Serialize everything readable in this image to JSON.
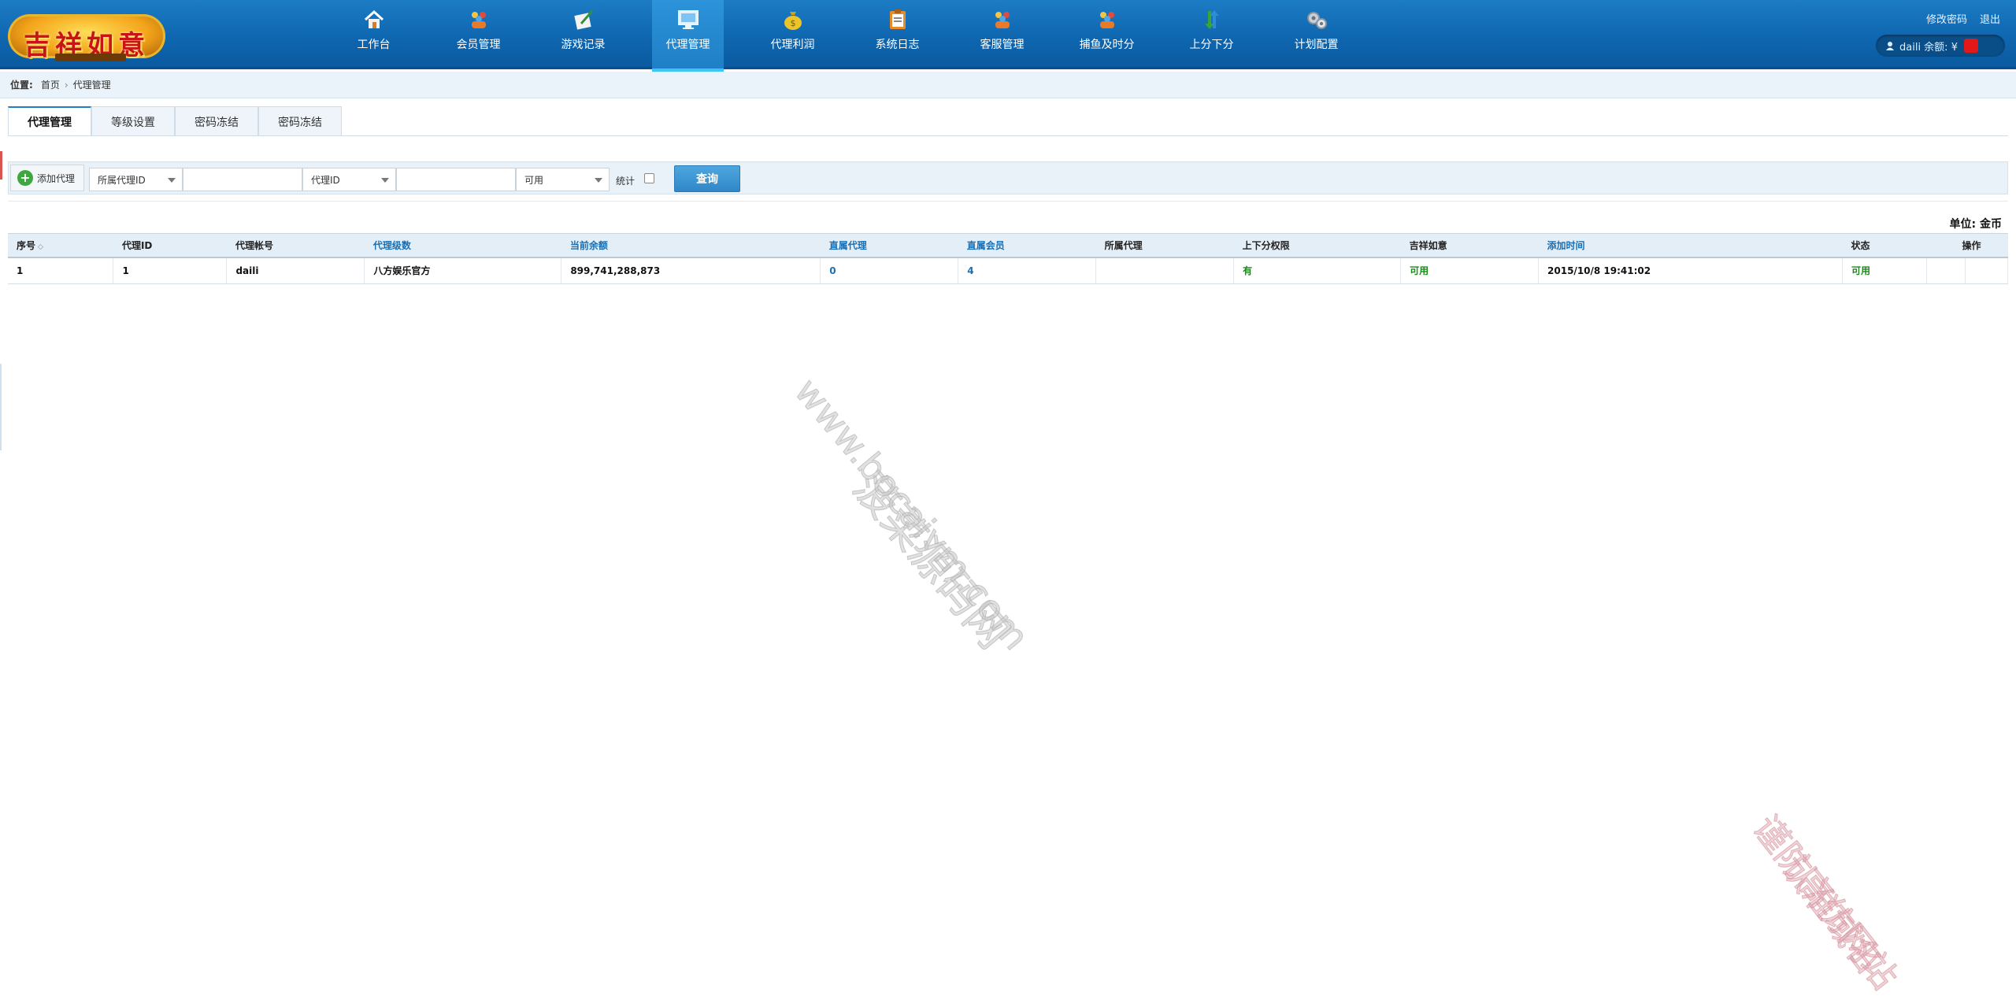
{
  "logo": {
    "text": "吉祥如意"
  },
  "nav": [
    {
      "label": "工作台",
      "icon": "home-icon"
    },
    {
      "label": "会员管理",
      "icon": "members-icon"
    },
    {
      "label": "游戏记录",
      "icon": "game-record-icon"
    },
    {
      "label": "代理管理",
      "icon": "monitor-icon"
    },
    {
      "label": "代理利润",
      "icon": "money-bag-icon"
    },
    {
      "label": "系统日志",
      "icon": "clipboard-icon"
    },
    {
      "label": "客服管理",
      "icon": "service-icon"
    },
    {
      "label": "捕鱼及时分",
      "icon": "fishing-icon"
    },
    {
      "label": "上分下分",
      "icon": "transfer-icon"
    },
    {
      "label": "计划配置",
      "icon": "gears-icon"
    }
  ],
  "header": {
    "change_password": "修改密码",
    "logout": "退出",
    "user_prefix": "daili 余额: ¥"
  },
  "breadcrumb": {
    "label": "位置:",
    "home": "首页",
    "current": "代理管理"
  },
  "tabs": [
    "代理管理",
    "等级设置",
    "密码冻结",
    "密码冻结"
  ],
  "filter": {
    "add_label": "添加代理",
    "select1": "所属代理ID",
    "select2": "代理ID",
    "select3": "可用",
    "stat_label": "统计",
    "query_label": "查询"
  },
  "unit_label": "单位: 金币",
  "table": {
    "headers": [
      "序号",
      "代理ID",
      "代理帐号",
      "代理级数",
      "当前余额",
      "直属代理",
      "直属会员",
      "所属代理",
      "上下分权限",
      "吉祥如意",
      "添加时间",
      "状态",
      "操作"
    ],
    "rows": [
      [
        "1",
        "1",
        "daili",
        "八方娱乐官方",
        "899,741,288,873",
        "0",
        "4",
        "",
        "有",
        "可用",
        "2015/10/8 19:41:02",
        "可用",
        "",
        ""
      ]
    ]
  },
  "watermarks": {
    "main_cn": "菠菜源码网",
    "main_url": "www.bocaiym.com",
    "corner1": "认准域名",
    "corner2": "谨防高仿网站"
  }
}
